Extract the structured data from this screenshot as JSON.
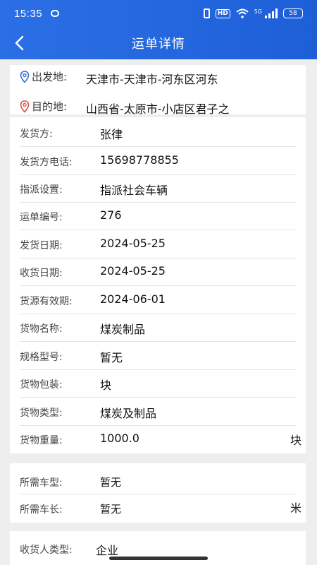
{
  "status_bar": {
    "time": "15:35",
    "hd": "HD",
    "signal_label": "5G",
    "battery": "58"
  },
  "header": {
    "title": "运单详情"
  },
  "route": {
    "origin_label": "出发地:",
    "origin_value": "天津市-天津市-河东区河东",
    "dest_label": "目的地:",
    "dest_value": "山西省-太原市-小店区君子之"
  },
  "details": [
    {
      "label": "发货方:",
      "value": "张律"
    },
    {
      "label": "发货方电话:",
      "value": "15698778855"
    },
    {
      "label": "指派设置:",
      "value": "指派社会车辆"
    },
    {
      "label": "运单编号:",
      "value": "276"
    },
    {
      "label": "发货日期:",
      "value": "2024-05-25"
    },
    {
      "label": "收货日期:",
      "value": "2024-05-25"
    },
    {
      "label": "货源有效期:",
      "value": "2024-06-01"
    },
    {
      "label": "货物名称:",
      "value": "煤炭制品"
    },
    {
      "label": "规格型号:",
      "value": "暂无"
    },
    {
      "label": "货物包装:",
      "value": "块"
    },
    {
      "label": "货物类型:",
      "value": "煤炭及制品"
    },
    {
      "label": "货物重量:",
      "value": "1000.0",
      "unit": "块"
    }
  ],
  "vehicle": {
    "type_label": "所需车型:",
    "type_value": "暂无",
    "length_label": "所需车长:",
    "length_value": "暂无",
    "length_unit": "米"
  },
  "receiver": {
    "type_label": "收货人类型:",
    "type_value": "企业"
  },
  "colors": {
    "header_bg": "#1e5fd8",
    "page_bg": "#eeeeee",
    "pin_origin": "#3b6fd6",
    "pin_dest": "#e0504a"
  }
}
